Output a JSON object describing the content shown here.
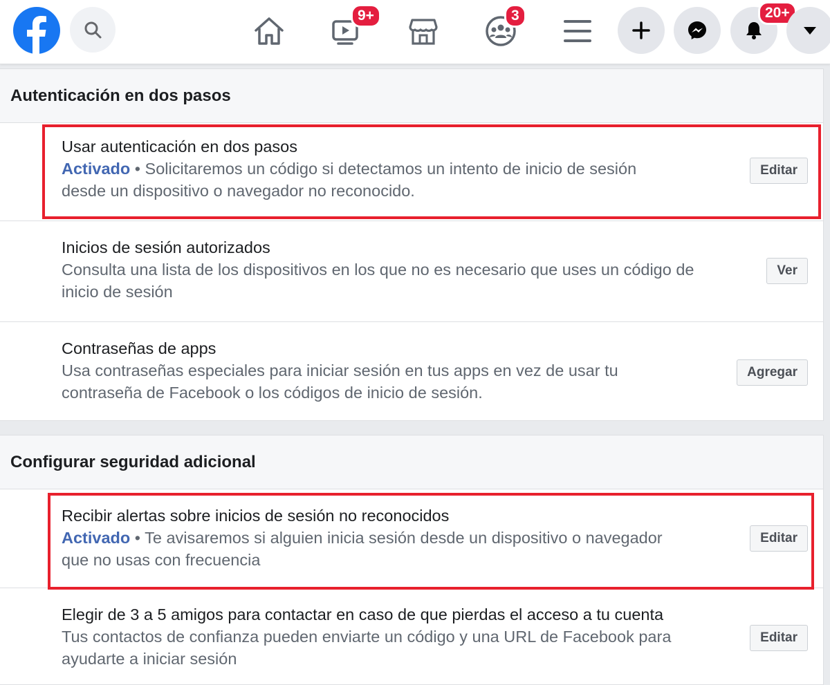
{
  "nav": {
    "badges": {
      "watch": "9+",
      "groups": "3",
      "notifications": "20+"
    },
    "colors": {
      "brand": "#1877f2",
      "badge": "#e41e3f",
      "active": "#4267b2",
      "highlight": "#e8202d"
    }
  },
  "sections": {
    "two_step": {
      "title": "Autenticación en dos pasos",
      "rows": [
        {
          "title": "Usar autenticación en dos pasos",
          "status": "Activado",
          "desc_line1": " • Solicitaremos un código si detectamos un intento de inicio de sesión",
          "desc_line2": "desde un dispositivo o navegador no reconocido.",
          "button": "Editar"
        },
        {
          "title": "Inicios de sesión autorizados",
          "desc_line1": "Consulta una lista de los dispositivos en los que no es necesario que uses un código de",
          "desc_line2": "inicio de sesión",
          "button": "Ver"
        },
        {
          "title": "Contraseñas de apps",
          "desc_line1": "Usa contraseñas especiales para iniciar sesión en tus apps en vez de usar tu",
          "desc_line2": "contraseña de Facebook o los códigos de inicio de sesión.",
          "button": "Agregar"
        }
      ]
    },
    "extra_security": {
      "title": "Configurar seguridad adicional",
      "rows": [
        {
          "title": "Recibir alertas sobre inicios de sesión no reconocidos",
          "status": "Activado",
          "desc_line1": " • Te avisaremos si alguien inicia sesión desde un dispositivo o navegador",
          "desc_line2": "que no usas con frecuencia",
          "button": "Editar"
        },
        {
          "title": "Elegir de 3 a 5 amigos para contactar en caso de que pierdas el acceso a tu cuenta",
          "desc_line1": "Tus contactos de confianza pueden enviarte un código y una URL de Facebook para",
          "desc_line2": "ayudarte a iniciar sesión",
          "button": "Editar"
        }
      ]
    }
  }
}
